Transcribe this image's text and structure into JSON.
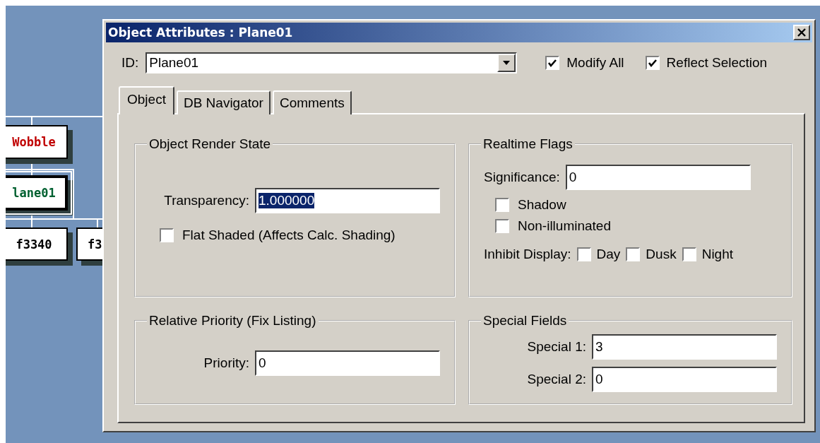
{
  "diagram": {
    "nodes": [
      {
        "label": "Wobble",
        "color": "#c00000",
        "selected": false
      },
      {
        "label": "lane01",
        "color": "#006030",
        "selected": true
      },
      {
        "label": "f3340",
        "color": "#000000",
        "selected": false
      },
      {
        "label": "f3",
        "color": "#000000",
        "selected": false
      }
    ]
  },
  "dialog": {
    "title": "Object Attributes : Plane01",
    "id_field": {
      "label": "ID:",
      "value": "Plane01"
    },
    "options": [
      {
        "label": "Modify All",
        "checked": true
      },
      {
        "label": "Reflect Selection",
        "checked": true
      }
    ],
    "tabs": [
      {
        "label": "Object",
        "selected": true
      },
      {
        "label": "DB Navigator",
        "selected": false
      },
      {
        "label": "Comments",
        "selected": false
      }
    ],
    "render_state": {
      "title": "Object Render State",
      "transparency": {
        "label": "Transparency:",
        "value": "1.000000",
        "text_selected": true
      },
      "flat_shaded": {
        "label": "Flat Shaded (Affects Calc. Shading)",
        "checked": false
      }
    },
    "priority": {
      "title": "Relative Priority (Fix Listing)",
      "field": {
        "label": "Priority:",
        "value": "0",
        "text_selected": false
      }
    },
    "realtime_flags": {
      "title": "Realtime Flags",
      "significance": {
        "label": "Significance:",
        "value": "0",
        "text_selected": false
      },
      "flags": [
        {
          "label": "Shadow",
          "checked": false
        },
        {
          "label": "Non-illuminated",
          "checked": false
        }
      ],
      "inhibit_display": {
        "label": "Inhibit Display:",
        "options": [
          {
            "label": "Day",
            "checked": false
          },
          {
            "label": "Dusk",
            "checked": false
          },
          {
            "label": "Night",
            "checked": false
          }
        ]
      }
    },
    "special_fields": {
      "title": "Special Fields",
      "fields": [
        {
          "label": "Special 1:",
          "value": "3",
          "text_selected": false
        },
        {
          "label": "Special 2:",
          "value": "0",
          "text_selected": false
        }
      ]
    }
  }
}
